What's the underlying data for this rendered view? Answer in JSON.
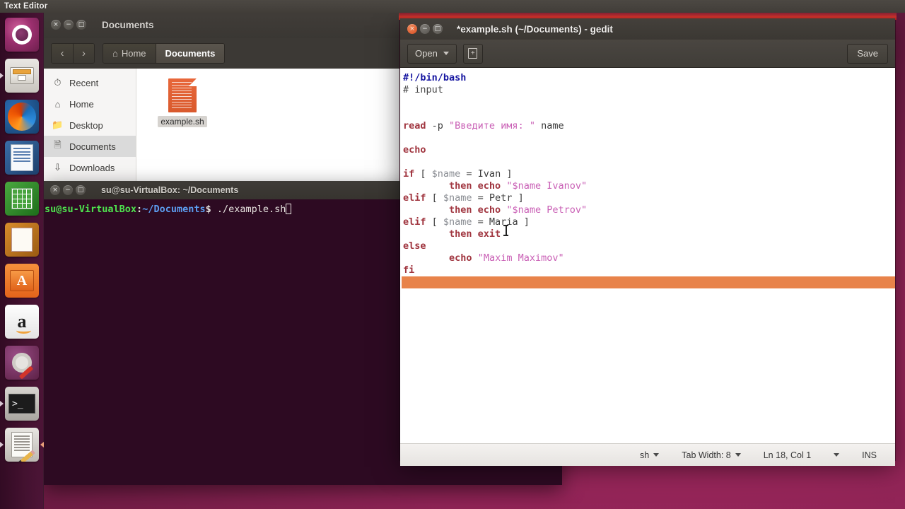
{
  "top_panel": {
    "app_name": "Text Editor"
  },
  "launcher": {
    "items": [
      {
        "name": "ubuntu-dash-icon",
        "label": "Ubuntu Dash",
        "icon": "ubuntu-icon"
      },
      {
        "name": "files-icon",
        "label": "Files",
        "icon": "file-cabinet-icon"
      },
      {
        "name": "firefox-icon",
        "label": "Firefox",
        "icon": "firefox-icon"
      },
      {
        "name": "libreoffice-writer-icon",
        "label": "LibreOffice Writer",
        "icon": "document-icon"
      },
      {
        "name": "libreoffice-calc-icon",
        "label": "LibreOffice Calc",
        "icon": "spreadsheet-icon"
      },
      {
        "name": "libreoffice-impress-icon",
        "label": "LibreOffice Impress",
        "icon": "presentation-icon"
      },
      {
        "name": "ubuntu-software-icon",
        "label": "Ubuntu Software",
        "icon": "shopping-bag-icon"
      },
      {
        "name": "amazon-icon",
        "label": "Amazon",
        "icon": "amazon-icon"
      },
      {
        "name": "system-settings-icon",
        "label": "System Settings",
        "icon": "gear-wrench-icon"
      },
      {
        "name": "terminal-icon",
        "label": "Terminal",
        "icon": "terminal-icon"
      },
      {
        "name": "gedit-icon",
        "label": "Text Editor",
        "icon": "pencil-page-icon"
      }
    ]
  },
  "nautilus": {
    "title": "Documents",
    "window_buttons": {
      "close": "close-icon",
      "minimize": "minimize-icon",
      "maximize": "maximize-icon"
    },
    "nav": {
      "back": "‹",
      "forward": "›"
    },
    "breadcrumbs": [
      {
        "label": "Home",
        "icon": "home-icon",
        "active": false
      },
      {
        "label": "Documents",
        "icon": "",
        "active": true
      }
    ],
    "sidebar": [
      {
        "label": "Recent",
        "icon": "clock-icon",
        "selected": false
      },
      {
        "label": "Home",
        "icon": "home-icon",
        "selected": false
      },
      {
        "label": "Desktop",
        "icon": "folder-icon",
        "selected": false
      },
      {
        "label": "Documents",
        "icon": "document-icon",
        "selected": true
      },
      {
        "label": "Downloads",
        "icon": "download-icon",
        "selected": false
      }
    ],
    "files": [
      {
        "label": "example.sh",
        "icon": "script-file-icon"
      }
    ]
  },
  "terminal": {
    "title": "su@su-VirtualBox: ~/Documents",
    "prompt_user": "su@su-VirtualBox",
    "prompt_colon": ":",
    "prompt_path": "~/Documents",
    "prompt_dollar": "$",
    "command": " ./example.sh",
    "cursor": "block-cursor"
  },
  "gedit": {
    "title": "*example.sh (~/Documents) - gedit",
    "toolbar": {
      "open_label": "Open",
      "open_caret": "chevron-down-icon",
      "new_tab_icon": "new-tab-icon",
      "save_label": "Save"
    },
    "statusbar": {
      "language": "sh",
      "tab_width": "Tab Width: 8",
      "position": "Ln 18, Col 1",
      "insert_mode": "INS"
    },
    "code_lines": [
      [
        {
          "t": "#!/bin/bash",
          "c": "k-shebang"
        }
      ],
      [
        {
          "t": "# input",
          "c": "k-comment"
        }
      ],
      [
        {
          "t": "",
          "c": "k-plain"
        }
      ],
      [
        {
          "t": "",
          "c": "k-plain"
        }
      ],
      [
        {
          "t": "read",
          "c": "k-kw"
        },
        {
          "t": " -p ",
          "c": "k-plain"
        },
        {
          "t": "\"Введите имя: \"",
          "c": "k-str"
        },
        {
          "t": " name",
          "c": "k-plain"
        }
      ],
      [
        {
          "t": "",
          "c": "k-plain"
        }
      ],
      [
        {
          "t": "echo",
          "c": "k-kw"
        }
      ],
      [
        {
          "t": "",
          "c": "k-plain"
        }
      ],
      [
        {
          "t": "if",
          "c": "k-kw"
        },
        {
          "t": " [ ",
          "c": "k-plain"
        },
        {
          "t": "$name",
          "c": "k-var"
        },
        {
          "t": " = Ivan ]",
          "c": "k-plain"
        }
      ],
      [
        {
          "t": "        ",
          "c": "k-plain"
        },
        {
          "t": "then echo",
          "c": "k-kw"
        },
        {
          "t": " ",
          "c": "k-plain"
        },
        {
          "t": "\"$name Ivanov\"",
          "c": "k-str"
        }
      ],
      [
        {
          "t": "elif",
          "c": "k-kw"
        },
        {
          "t": " [ ",
          "c": "k-plain"
        },
        {
          "t": "$name",
          "c": "k-var"
        },
        {
          "t": " = Petr ]",
          "c": "k-plain"
        }
      ],
      [
        {
          "t": "        ",
          "c": "k-plain"
        },
        {
          "t": "then echo",
          "c": "k-kw"
        },
        {
          "t": " ",
          "c": "k-plain"
        },
        {
          "t": "\"$name Petrov\"",
          "c": "k-str"
        }
      ],
      [
        {
          "t": "elif",
          "c": "k-kw"
        },
        {
          "t": " [ ",
          "c": "k-plain"
        },
        {
          "t": "$name",
          "c": "k-var"
        },
        {
          "t": " = Maria ]",
          "c": "k-plain"
        }
      ],
      [
        {
          "t": "        ",
          "c": "k-plain"
        },
        {
          "t": "then exit",
          "c": "k-kw"
        }
      ],
      [
        {
          "t": "else",
          "c": "k-kw"
        }
      ],
      [
        {
          "t": "        ",
          "c": "k-plain"
        },
        {
          "t": "echo",
          "c": "k-kw"
        },
        {
          "t": " ",
          "c": "k-plain"
        },
        {
          "t": "\"Maxim Maximov\"",
          "c": "k-str"
        }
      ],
      [
        {
          "t": "fi",
          "c": "k-kw"
        }
      ]
    ],
    "current_line_index": 17,
    "colors": {
      "current_line_highlight": "#e8834a",
      "keyword": "#a0353f",
      "string": "#c95fb5",
      "variable": "#8a8d93",
      "shebang": "#1414a0"
    }
  }
}
